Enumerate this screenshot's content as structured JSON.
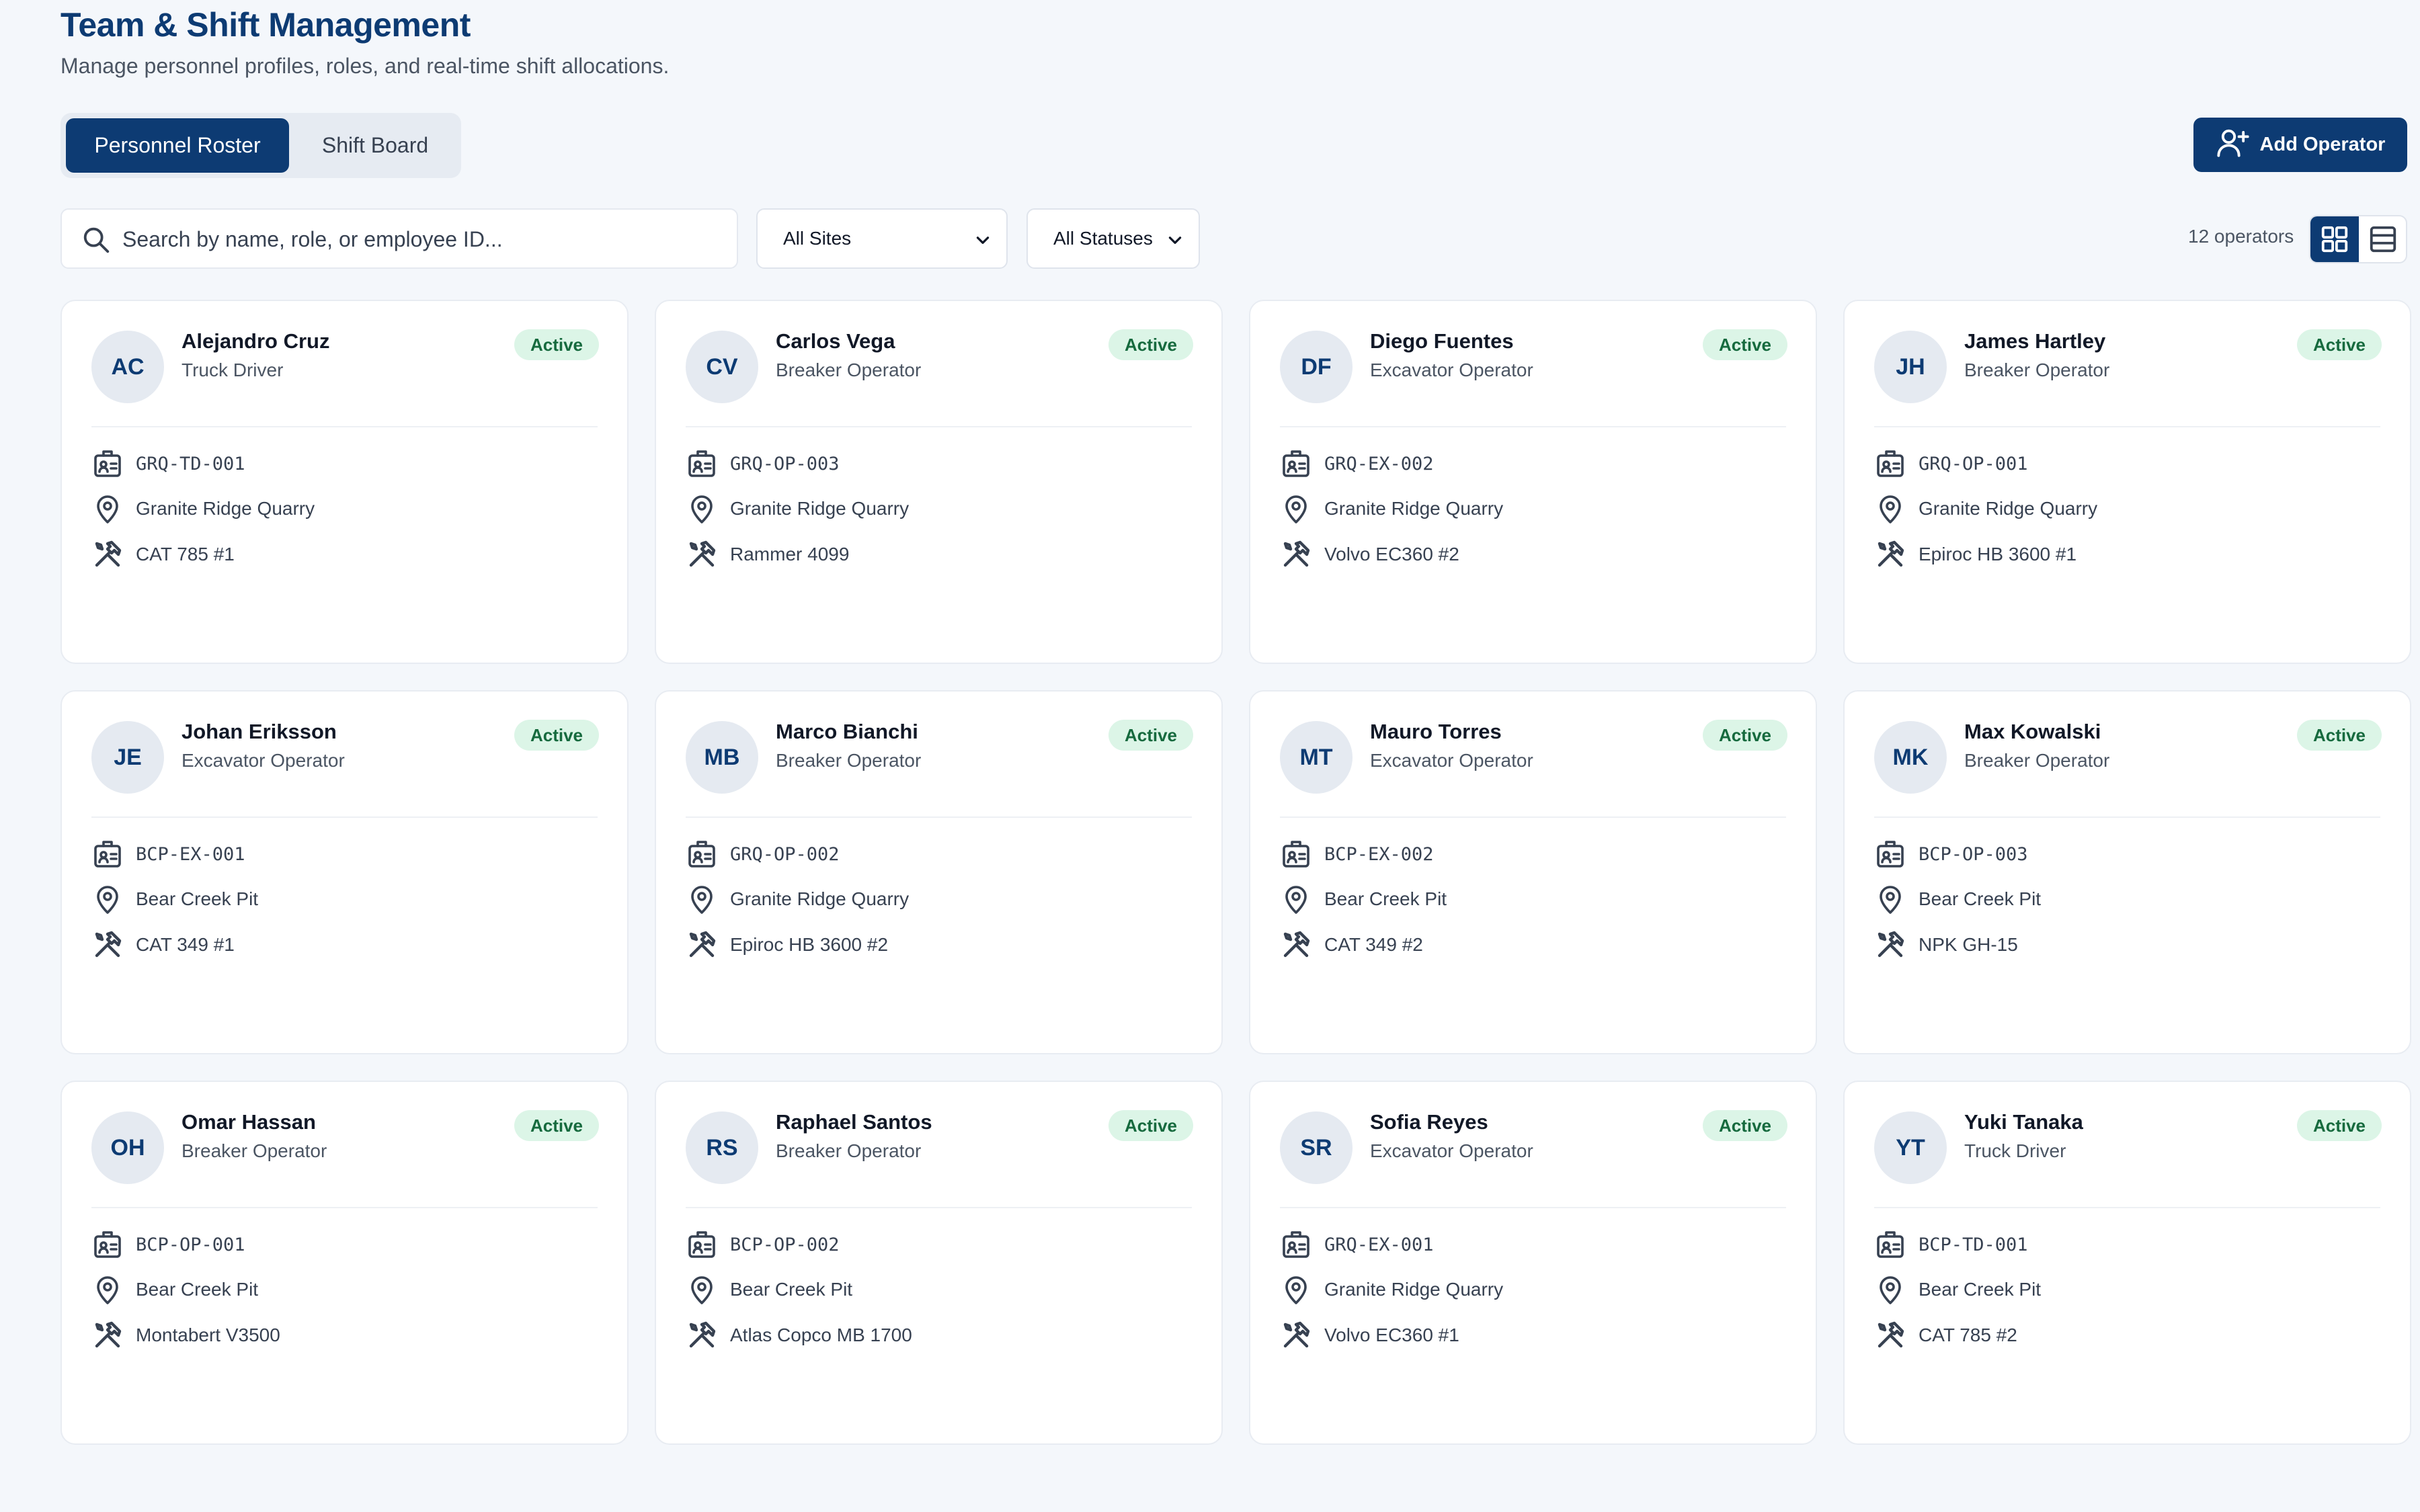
{
  "header": {
    "title": "Team & Shift Management",
    "subtitle": "Manage personnel profiles, roles, and real-time shift allocations."
  },
  "tabs": [
    {
      "label": "Personnel Roster",
      "active": true
    },
    {
      "label": "Shift Board",
      "active": false
    }
  ],
  "actions": {
    "add_operator_label": "Add Operator"
  },
  "filters": {
    "search_placeholder": "Search by name, role, or employee ID...",
    "site_selected": "All Sites",
    "status_selected": "All Statuses"
  },
  "summary": {
    "count_label": "12 operators"
  },
  "view_toggle": {
    "active": "grid"
  },
  "colors": {
    "primary": "#0d3b73",
    "badge_bg": "#dcf5e7",
    "badge_text": "#166a3e"
  },
  "operators": [
    {
      "initials": "AC",
      "name": "Alejandro Cruz",
      "role": "Truck Driver",
      "status": "Active",
      "employee_id": "GRQ-TD-001",
      "site": "Granite Ridge Quarry",
      "equipment": "CAT 785 #1"
    },
    {
      "initials": "CV",
      "name": "Carlos Vega",
      "role": "Breaker Operator",
      "status": "Active",
      "employee_id": "GRQ-OP-003",
      "site": "Granite Ridge Quarry",
      "equipment": "Rammer 4099"
    },
    {
      "initials": "DF",
      "name": "Diego Fuentes",
      "role": "Excavator Operator",
      "status": "Active",
      "employee_id": "GRQ-EX-002",
      "site": "Granite Ridge Quarry",
      "equipment": "Volvo EC360 #2"
    },
    {
      "initials": "JH",
      "name": "James Hartley",
      "role": "Breaker Operator",
      "status": "Active",
      "employee_id": "GRQ-OP-001",
      "site": "Granite Ridge Quarry",
      "equipment": "Epiroc HB 3600 #1"
    },
    {
      "initials": "JE",
      "name": "Johan Eriksson",
      "role": "Excavator Operator",
      "status": "Active",
      "employee_id": "BCP-EX-001",
      "site": "Bear Creek Pit",
      "equipment": "CAT 349 #1"
    },
    {
      "initials": "MB",
      "name": "Marco Bianchi",
      "role": "Breaker Operator",
      "status": "Active",
      "employee_id": "GRQ-OP-002",
      "site": "Granite Ridge Quarry",
      "equipment": "Epiroc HB 3600 #2"
    },
    {
      "initials": "MT",
      "name": "Mauro Torres",
      "role": "Excavator Operator",
      "status": "Active",
      "employee_id": "BCP-EX-002",
      "site": "Bear Creek Pit",
      "equipment": "CAT 349 #2"
    },
    {
      "initials": "MK",
      "name": "Max Kowalski",
      "role": "Breaker Operator",
      "status": "Active",
      "employee_id": "BCP-OP-003",
      "site": "Bear Creek Pit",
      "equipment": "NPK GH-15"
    },
    {
      "initials": "OH",
      "name": "Omar Hassan",
      "role": "Breaker Operator",
      "status": "Active",
      "employee_id": "BCP-OP-001",
      "site": "Bear Creek Pit",
      "equipment": "Montabert V3500"
    },
    {
      "initials": "RS",
      "name": "Raphael Santos",
      "role": "Breaker Operator",
      "status": "Active",
      "employee_id": "BCP-OP-002",
      "site": "Bear Creek Pit",
      "equipment": "Atlas Copco MB 1700"
    },
    {
      "initials": "SR",
      "name": "Sofia Reyes",
      "role": "Excavator Operator",
      "status": "Active",
      "employee_id": "GRQ-EX-001",
      "site": "Granite Ridge Quarry",
      "equipment": "Volvo EC360 #1"
    },
    {
      "initials": "YT",
      "name": "Yuki Tanaka",
      "role": "Truck Driver",
      "status": "Active",
      "employee_id": "BCP-TD-001",
      "site": "Bear Creek Pit",
      "equipment": "CAT 785 #2"
    }
  ]
}
